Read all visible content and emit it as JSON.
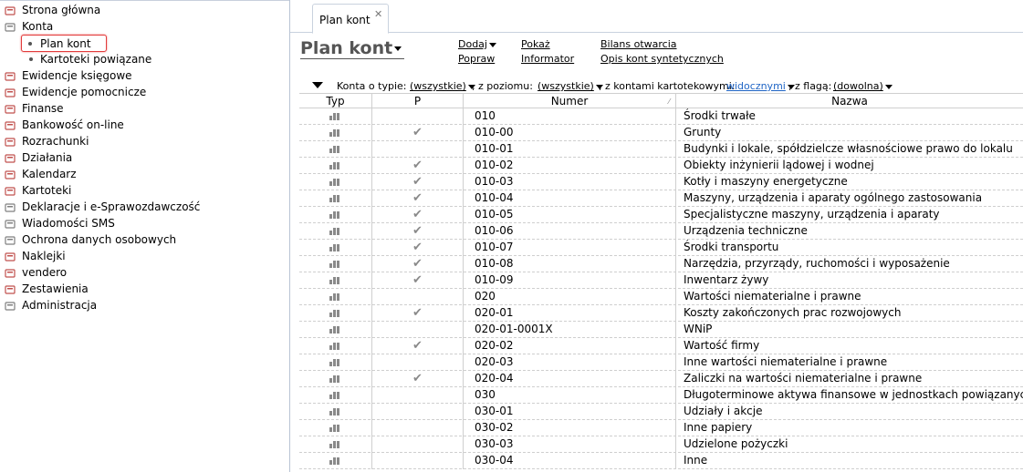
{
  "sidebar": {
    "items": [
      {
        "label": "Strona główna",
        "icon": "home-icon"
      },
      {
        "label": "Konta",
        "icon": "accounts-icon"
      },
      {
        "label": "Ewidencje księgowe",
        "icon": "ledger-icon"
      },
      {
        "label": "Ewidencje pomocnicze",
        "icon": "ledger-icon"
      },
      {
        "label": "Finanse",
        "icon": "finance-icon"
      },
      {
        "label": "Bankowość on-line",
        "icon": "bank-icon"
      },
      {
        "label": "Rozrachunki",
        "icon": "settlements-icon"
      },
      {
        "label": "Działania",
        "icon": "actions-icon"
      },
      {
        "label": "Kalendarz",
        "icon": "calendar-icon"
      },
      {
        "label": "Kartoteki",
        "icon": "cards-icon"
      },
      {
        "label": "Deklaracje i e-Sprawozdawczość",
        "icon": "declarations-icon"
      },
      {
        "label": "Wiadomości SMS",
        "icon": "sms-icon"
      },
      {
        "label": "Ochrona danych osobowych",
        "icon": "shield-icon"
      },
      {
        "label": "Naklejki",
        "icon": "stickers-icon"
      },
      {
        "label": "vendero",
        "icon": "vendero-icon"
      },
      {
        "label": "Zestawienia",
        "icon": "reports-icon"
      },
      {
        "label": "Administracja",
        "icon": "admin-icon"
      }
    ],
    "sub_items": [
      {
        "label": "Plan kont",
        "active": true
      },
      {
        "label": "Kartoteki powiązane",
        "active": false
      }
    ]
  },
  "tab": {
    "label": "Plan kont",
    "close": "✕"
  },
  "page_title": "Plan kont",
  "actions": {
    "dodaj": "Dodaj",
    "popraw": "Popraw",
    "pokaz": "Pokaż",
    "informator": "Informator",
    "bilans": "Bilans otwarcia",
    "opis": "Opis kont syntetycznych"
  },
  "filter": {
    "konta_label": "Konta o typie:",
    "konta_value": "(wszystkie)",
    "poziom_label": ", z poziomu:",
    "poziom_value": "(wszystkie)",
    "kartoteki_label": ", z kontami kartotekowymi:",
    "kartoteki_value": "widocznymi",
    "flaga_label": ", z flagą:",
    "flaga_value": "(dowolna)"
  },
  "columns": {
    "typ": "Typ",
    "p": "P",
    "numer": "Numer",
    "nazwa": "Nazwa"
  },
  "rows": [
    {
      "p": false,
      "numer": "010",
      "nazwa": "Środki trwałe"
    },
    {
      "p": true,
      "numer": "010-00",
      "nazwa": "Grunty"
    },
    {
      "p": false,
      "numer": "010-01",
      "nazwa": "Budynki i lokale, spółdzielcze własnościowe prawo do lokalu"
    },
    {
      "p": true,
      "numer": "010-02",
      "nazwa": "Obiekty inżynierii lądowej i wodnej"
    },
    {
      "p": true,
      "numer": "010-03",
      "nazwa": "Kotły i maszyny energetyczne"
    },
    {
      "p": true,
      "numer": "010-04",
      "nazwa": "Maszyny, urządzenia i aparaty ogólnego zastosowania"
    },
    {
      "p": true,
      "numer": "010-05",
      "nazwa": "Specjalistyczne maszyny, urządzenia i aparaty"
    },
    {
      "p": true,
      "numer": "010-06",
      "nazwa": "Urządzenia techniczne"
    },
    {
      "p": true,
      "numer": "010-07",
      "nazwa": "Środki transportu"
    },
    {
      "p": true,
      "numer": "010-08",
      "nazwa": "Narzędzia, przyrządy, ruchomości i wyposażenie"
    },
    {
      "p": true,
      "numer": "010-09",
      "nazwa": "Inwentarz żywy"
    },
    {
      "p": false,
      "numer": "020",
      "nazwa": "Wartości niematerialne i prawne"
    },
    {
      "p": true,
      "numer": "020-01",
      "nazwa": "Koszty zakończonych prac rozwojowych"
    },
    {
      "p": false,
      "numer": "020-01-0001X",
      "nazwa": "WNiP"
    },
    {
      "p": true,
      "numer": "020-02",
      "nazwa": "Wartość firmy"
    },
    {
      "p": false,
      "numer": "020-03",
      "nazwa": "Inne wartości niematerialne i prawne"
    },
    {
      "p": true,
      "numer": "020-04",
      "nazwa": "Zaliczki na wartości niematerialne i prawne"
    },
    {
      "p": false,
      "numer": "030",
      "nazwa": "Długoterminowe aktywa finansowe w jednostkach powiązanyc"
    },
    {
      "p": false,
      "numer": "030-01",
      "nazwa": "Udziały i akcje"
    },
    {
      "p": false,
      "numer": "030-02",
      "nazwa": "Inne papiery"
    },
    {
      "p": false,
      "numer": "030-03",
      "nazwa": "Udzielone pożyczki"
    },
    {
      "p": false,
      "numer": "030-04",
      "nazwa": "Inne"
    }
  ],
  "colors": {
    "active_border": "#e23b3b",
    "link_blue": "#2166c6"
  }
}
